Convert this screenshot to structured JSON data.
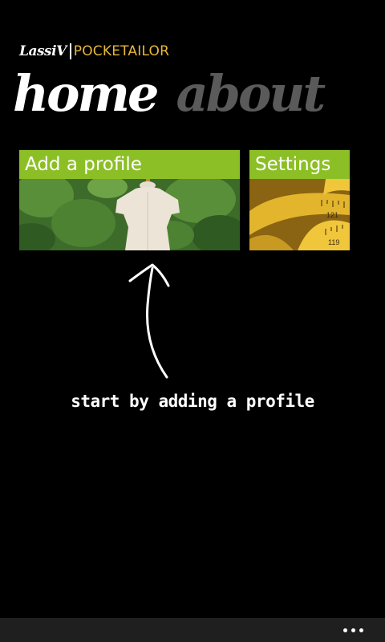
{
  "header": {
    "brand_logo": "LassiV",
    "app_title": "POCKETAILOR"
  },
  "pivot": {
    "items": [
      {
        "label": "home",
        "active": true
      },
      {
        "label": "about",
        "active": false
      }
    ]
  },
  "tiles": [
    {
      "label": "Add a profile",
      "image_icon": "dress-form-mannequin-icon",
      "color": "#8cbf26"
    },
    {
      "label": "Settings",
      "image_icon": "tape-measure-icon",
      "color": "#8cbf26"
    }
  ],
  "hint": {
    "text": "start by adding a profile",
    "icon": "hand-drawn-arrow-up-icon"
  },
  "app_bar": {
    "menu_icon": "ellipsis-icon"
  },
  "colors": {
    "background": "#000000",
    "accent": "#8cbf26",
    "app_title": "#e8b83a",
    "inactive_pivot": "#5a5a5a",
    "app_bar": "#1f1f1f"
  }
}
